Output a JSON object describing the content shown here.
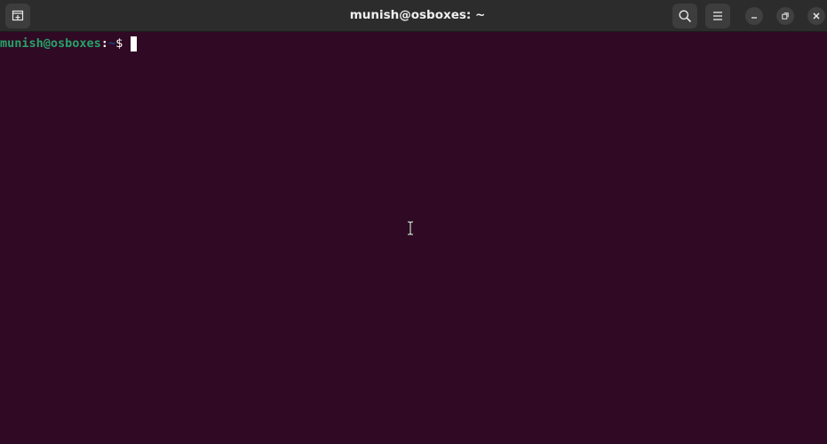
{
  "window": {
    "title": "munish@osboxes: ~"
  },
  "terminal": {
    "prompt_user_host": "munish@osboxes",
    "prompt_colon": ":",
    "prompt_path": "~",
    "prompt_symbol": "$ ",
    "input_text": ""
  },
  "colors": {
    "terminal_bg": "#300a24",
    "titlebar_bg": "#2c2c2c",
    "user_host": "#26a269",
    "path": "#12488b"
  },
  "icons": {
    "new_tab": "new-tab-icon",
    "search": "search-icon",
    "menu": "hamburger-menu-icon",
    "minimize": "minimize-icon",
    "maximize": "maximize-icon",
    "close": "close-icon"
  }
}
